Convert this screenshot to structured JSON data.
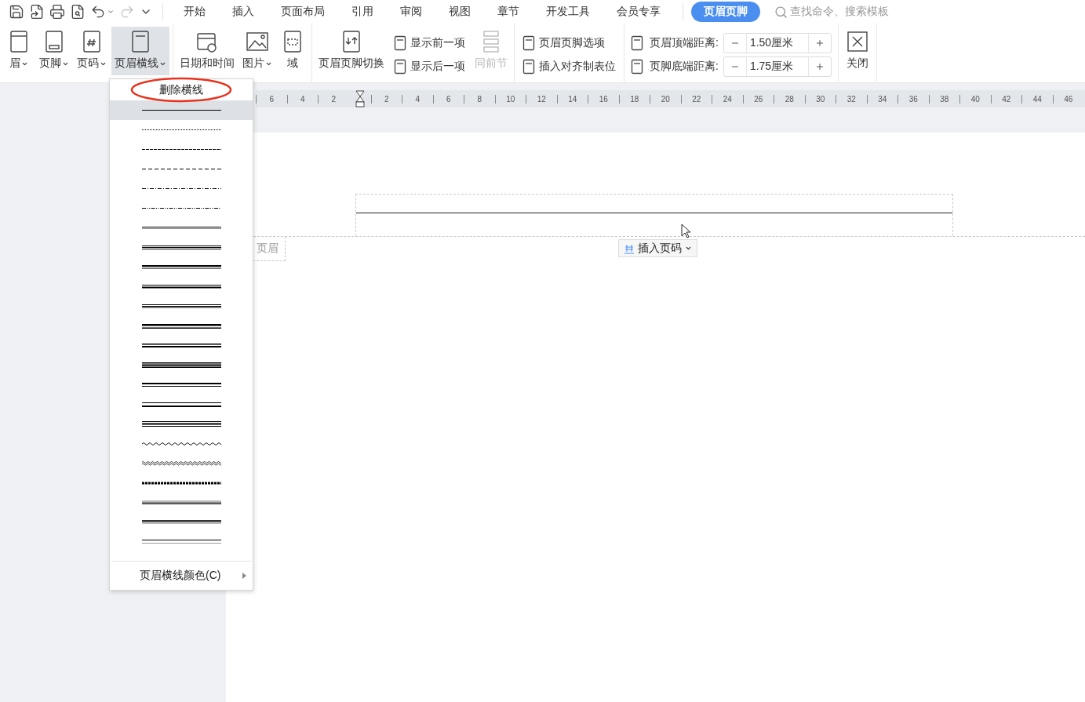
{
  "quick_access": [
    {
      "kind": "save",
      "disabled": false
    },
    {
      "kind": "export",
      "disabled": false
    },
    {
      "kind": "print",
      "disabled": false
    },
    {
      "kind": "preview",
      "disabled": false
    },
    {
      "kind": "undo",
      "disabled": false
    },
    {
      "kind": "redo",
      "disabled": true
    },
    {
      "kind": "more",
      "disabled": false
    }
  ],
  "menu_tabs": [
    {
      "label": "开始",
      "selected": false
    },
    {
      "label": "插入",
      "selected": false
    },
    {
      "label": "页面布局",
      "selected": false
    },
    {
      "label": "引用",
      "selected": false
    },
    {
      "label": "审阅",
      "selected": false
    },
    {
      "label": "视图",
      "selected": false
    },
    {
      "label": "章节",
      "selected": false
    },
    {
      "label": "开发工具",
      "selected": false
    },
    {
      "label": "会员专享",
      "selected": false
    },
    {
      "label": "页眉页脚",
      "selected": true
    }
  ],
  "search": {
    "placeholder": "查找命令、搜索模板"
  },
  "ribbon": {
    "groups": [
      {
        "items": [
          {
            "kind": "big",
            "label": "眉",
            "dropdown": true,
            "active": false,
            "disabled": false
          },
          {
            "kind": "big",
            "label": "页脚",
            "dropdown": true,
            "active": false,
            "disabled": false
          },
          {
            "kind": "big",
            "label": "页码",
            "dropdown": true,
            "active": false,
            "disabled": false
          },
          {
            "kind": "big",
            "label": "页眉横线",
            "dropdown": true,
            "active": true,
            "disabled": false
          }
        ]
      },
      {
        "items": [
          {
            "kind": "big",
            "label": "日期和时间",
            "dropdown": false,
            "active": false,
            "disabled": false
          },
          {
            "kind": "big",
            "label": "图片",
            "dropdown": true,
            "active": false,
            "disabled": false
          },
          {
            "kind": "big",
            "label": "域",
            "dropdown": false,
            "active": false,
            "disabled": false
          }
        ]
      },
      {
        "items": [
          {
            "kind": "big",
            "label": "页眉页脚切换",
            "dropdown": false,
            "active": false,
            "disabled": false
          },
          {
            "kind": "stack",
            "items": [
              {
                "label": "显示前一项"
              },
              {
                "label": "显示后一项"
              }
            ]
          },
          {
            "kind": "big",
            "label": "同前节",
            "dropdown": false,
            "active": false,
            "disabled": true
          }
        ]
      },
      {
        "items": [
          {
            "kind": "stack",
            "items": [
              {
                "label": "页眉页脚选项"
              },
              {
                "label": "插入对齐制表位"
              }
            ]
          }
        ]
      },
      {
        "items": [
          {
            "kind": "spin",
            "items": [
              {
                "label": "页眉顶端距离:",
                "value": "1.50厘米"
              },
              {
                "label": "页脚底端距离:",
                "value": "1.75厘米"
              }
            ]
          }
        ]
      },
      {
        "items": [
          {
            "kind": "big",
            "label": "关闭",
            "dropdown": false,
            "active": false,
            "disabled": false
          }
        ]
      }
    ]
  },
  "ruler": {
    "left_labels": [
      "6",
      "4",
      "2"
    ],
    "right_labels": [
      "2",
      "4",
      "6",
      "8",
      "10",
      "12",
      "14",
      "16",
      "18",
      "20",
      "22",
      "24",
      "26",
      "28",
      "30",
      "32",
      "34",
      "36",
      "38",
      "40",
      "42",
      "44",
      "46"
    ]
  },
  "document": {
    "header_tag": "页眉",
    "insert_page_number": {
      "label": "插入页码",
      "dropdown": true
    }
  },
  "line_menu": {
    "delete_item": {
      "label": "删除横线",
      "annotated": true
    },
    "styles": [
      {
        "kind": "solid",
        "selected": true
      },
      {
        "kind": "dotted",
        "selected": false
      },
      {
        "kind": "dashed",
        "selected": false
      },
      {
        "kind": "long-dash",
        "selected": false
      },
      {
        "kind": "dash-dot",
        "selected": false
      },
      {
        "kind": "dash-dot-dot",
        "selected": false
      },
      {
        "kind": "double",
        "selected": false
      },
      {
        "kind": "triple",
        "selected": false
      },
      {
        "kind": "thick-thin",
        "selected": false
      },
      {
        "kind": "thin-thick",
        "selected": false
      },
      {
        "kind": "thin-thick-thin",
        "selected": false
      },
      {
        "kind": "heavy-thin",
        "selected": false
      },
      {
        "kind": "heavy-thick",
        "selected": false
      },
      {
        "kind": "heavy-triple",
        "selected": false
      },
      {
        "kind": "thick-gap-thin",
        "selected": false
      },
      {
        "kind": "thin-gap-thick",
        "selected": false
      },
      {
        "kind": "thin-thick-thin-gap",
        "selected": false
      },
      {
        "kind": "wave",
        "selected": false
      },
      {
        "kind": "double-wave",
        "selected": false
      },
      {
        "kind": "hatched",
        "selected": false
      },
      {
        "kind": "emboss",
        "selected": false
      },
      {
        "kind": "engrave",
        "selected": false
      },
      {
        "kind": "outset",
        "selected": false
      }
    ],
    "color_item": {
      "label": "页眉横线颜色(C)",
      "submenu": true
    }
  }
}
